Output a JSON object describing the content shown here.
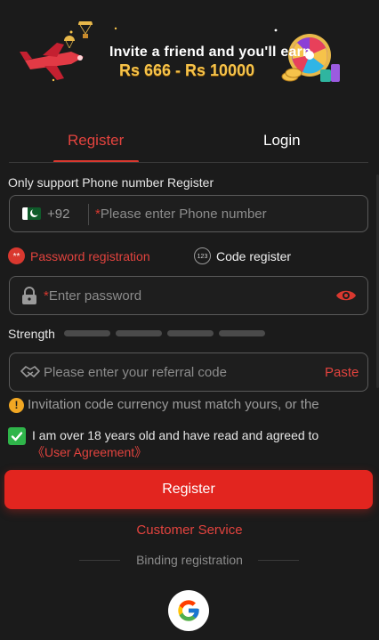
{
  "banner": {
    "title": "Invite a friend and you'll earn",
    "amount": "Rs 666 - Rs 10000"
  },
  "tabs": [
    {
      "label": "Register",
      "active": true
    },
    {
      "label": "Login",
      "active": false
    }
  ],
  "form": {
    "info_label": "Only support Phone number Register",
    "country_code": "+92",
    "phone_required_mark": "*",
    "phone_placeholder": "Please enter Phone number",
    "password_mode_label": "Password registration",
    "password_badge": "**",
    "code_mode_label": "Code register",
    "code_badge": "123",
    "password_required_mark": "*",
    "password_placeholder": "Enter password",
    "strength_label": "Strength",
    "strength_level": 0,
    "referral_placeholder": "Please enter your referral code",
    "paste_label": "Paste",
    "notice_text": "Invitation code currency must match yours, or the",
    "agree_text": "I am over 18 years old and have read and agreed to",
    "agreement_link": "《User Agreement》",
    "agree_checked": true
  },
  "register_button": "Register",
  "customer_service": "Customer Service",
  "binding_label": "Binding registration",
  "colors": {
    "accent": "#e2251f",
    "link_red": "#e2433e",
    "background": "#1b1b1b",
    "check_green": "#2fb54a",
    "warning": "#f1a723"
  }
}
